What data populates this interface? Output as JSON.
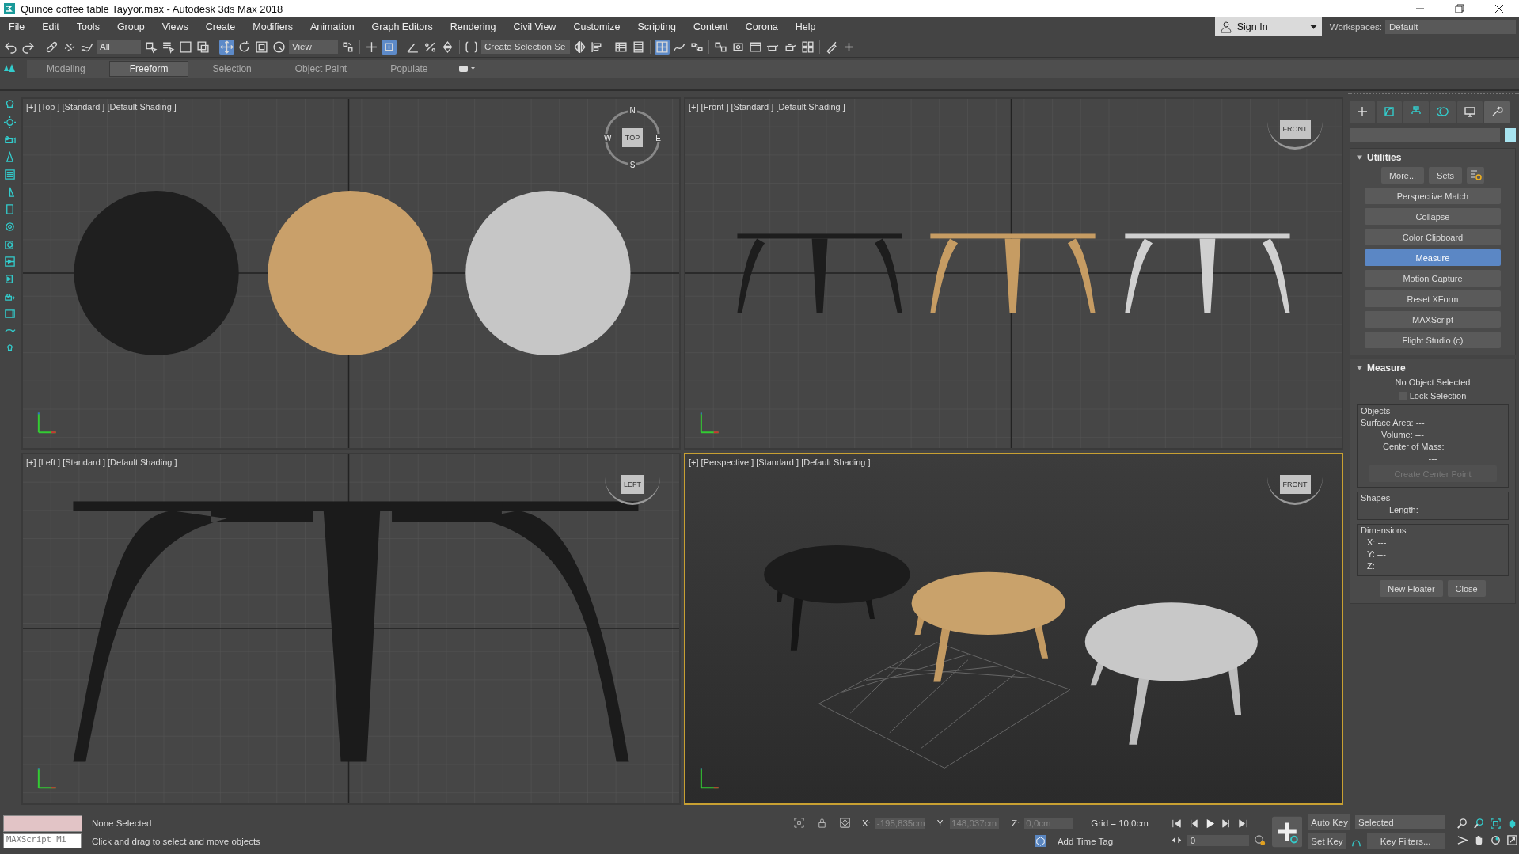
{
  "window": {
    "title": "Quince coffee table Tayyor.max - Autodesk 3ds Max 2018"
  },
  "menu": [
    "File",
    "Edit",
    "Tools",
    "Group",
    "Views",
    "Create",
    "Modifiers",
    "Animation",
    "Graph Editors",
    "Rendering",
    "Civil View",
    "Customize",
    "Scripting",
    "Content",
    "Corona",
    "Help"
  ],
  "account": {
    "label": "Sign In"
  },
  "workspaces": {
    "label": "Workspaces:",
    "value": "Default"
  },
  "toolbar": {
    "filter": "All",
    "reference": "View",
    "selection_set": "Create Selection Se"
  },
  "ribbon_tabs": [
    {
      "label": "Modeling",
      "selected": false
    },
    {
      "label": "Freeform",
      "selected": true
    },
    {
      "label": "Selection",
      "selected": false
    },
    {
      "label": "Object Paint",
      "selected": false
    },
    {
      "label": "Populate",
      "selected": false
    }
  ],
  "viewports": [
    {
      "kind": "top",
      "label": "[+] [Top ] [Standard ] [Default Shading ]",
      "cube": "TOP",
      "active": false
    },
    {
      "kind": "front",
      "label": "[+] [Front ] [Standard ] [Default Shading ]",
      "cube": "FRONT",
      "active": false
    },
    {
      "kind": "left",
      "label": "[+] [Left ] [Standard ] [Default Shading ]",
      "cube": "LEFT",
      "active": false
    },
    {
      "kind": "perspective",
      "label": "[+] [Perspective ] [Standard ] [Default Shading ]",
      "cube": "FRONT",
      "active": true
    }
  ],
  "compass": [
    "N",
    "S",
    "W",
    "E"
  ],
  "command_tabs": [
    {
      "kind": "create",
      "selected": false
    },
    {
      "kind": "modify",
      "selected": false
    },
    {
      "kind": "hierarchy",
      "selected": false
    },
    {
      "kind": "motion",
      "selected": false
    },
    {
      "kind": "display",
      "selected": false
    },
    {
      "kind": "utilities",
      "selected": true
    }
  ],
  "utilities": {
    "title": "Utilities",
    "more": "More...",
    "sets": "Sets",
    "buttons": [
      {
        "label": "Perspective Match",
        "selected": false
      },
      {
        "label": "Collapse",
        "selected": false
      },
      {
        "label": "Color Clipboard",
        "selected": false
      },
      {
        "label": "Measure",
        "selected": true
      },
      {
        "label": "Motion Capture",
        "selected": false
      },
      {
        "label": "Reset XForm",
        "selected": false
      },
      {
        "label": "MAXScript",
        "selected": false
      },
      {
        "label": "Flight Studio (c)",
        "selected": false
      }
    ]
  },
  "measure": {
    "title": "Measure",
    "status": "No Object Selected",
    "lock": {
      "label": "Lock Selection",
      "checked": false
    },
    "objects": {
      "title": "Objects",
      "surface_area": "Surface Area: ---",
      "volume": "Volume: ---",
      "center_of_mass": "Center of Mass:",
      "center_value": "---",
      "button": {
        "label": "Create Center Point",
        "disabled": true
      }
    },
    "shapes": {
      "title": "Shapes",
      "length": "Length: ---"
    },
    "dimensions": {
      "title": "Dimensions",
      "rows": [
        "X:  ---",
        "Y:  ---",
        "Z:  ---"
      ]
    },
    "buttons": [
      "New Floater",
      "Close"
    ]
  },
  "status_bar": {
    "listener": "MAXScript Mi",
    "selection": "None Selected",
    "prompt": "Click and drag to select and move objects",
    "x_label": "X:",
    "x": "-195,835cm",
    "y_label": "Y:",
    "y": "148,037cm",
    "z_label": "Z:",
    "z": "0,0cm",
    "grid": "Grid = 10,0cm",
    "time_tag": "Add Time Tag",
    "auto_key": "Auto Key",
    "set_key": "Set Key",
    "key_mode": "Selected",
    "frame": "0",
    "key_filters": "Key Filters..."
  }
}
